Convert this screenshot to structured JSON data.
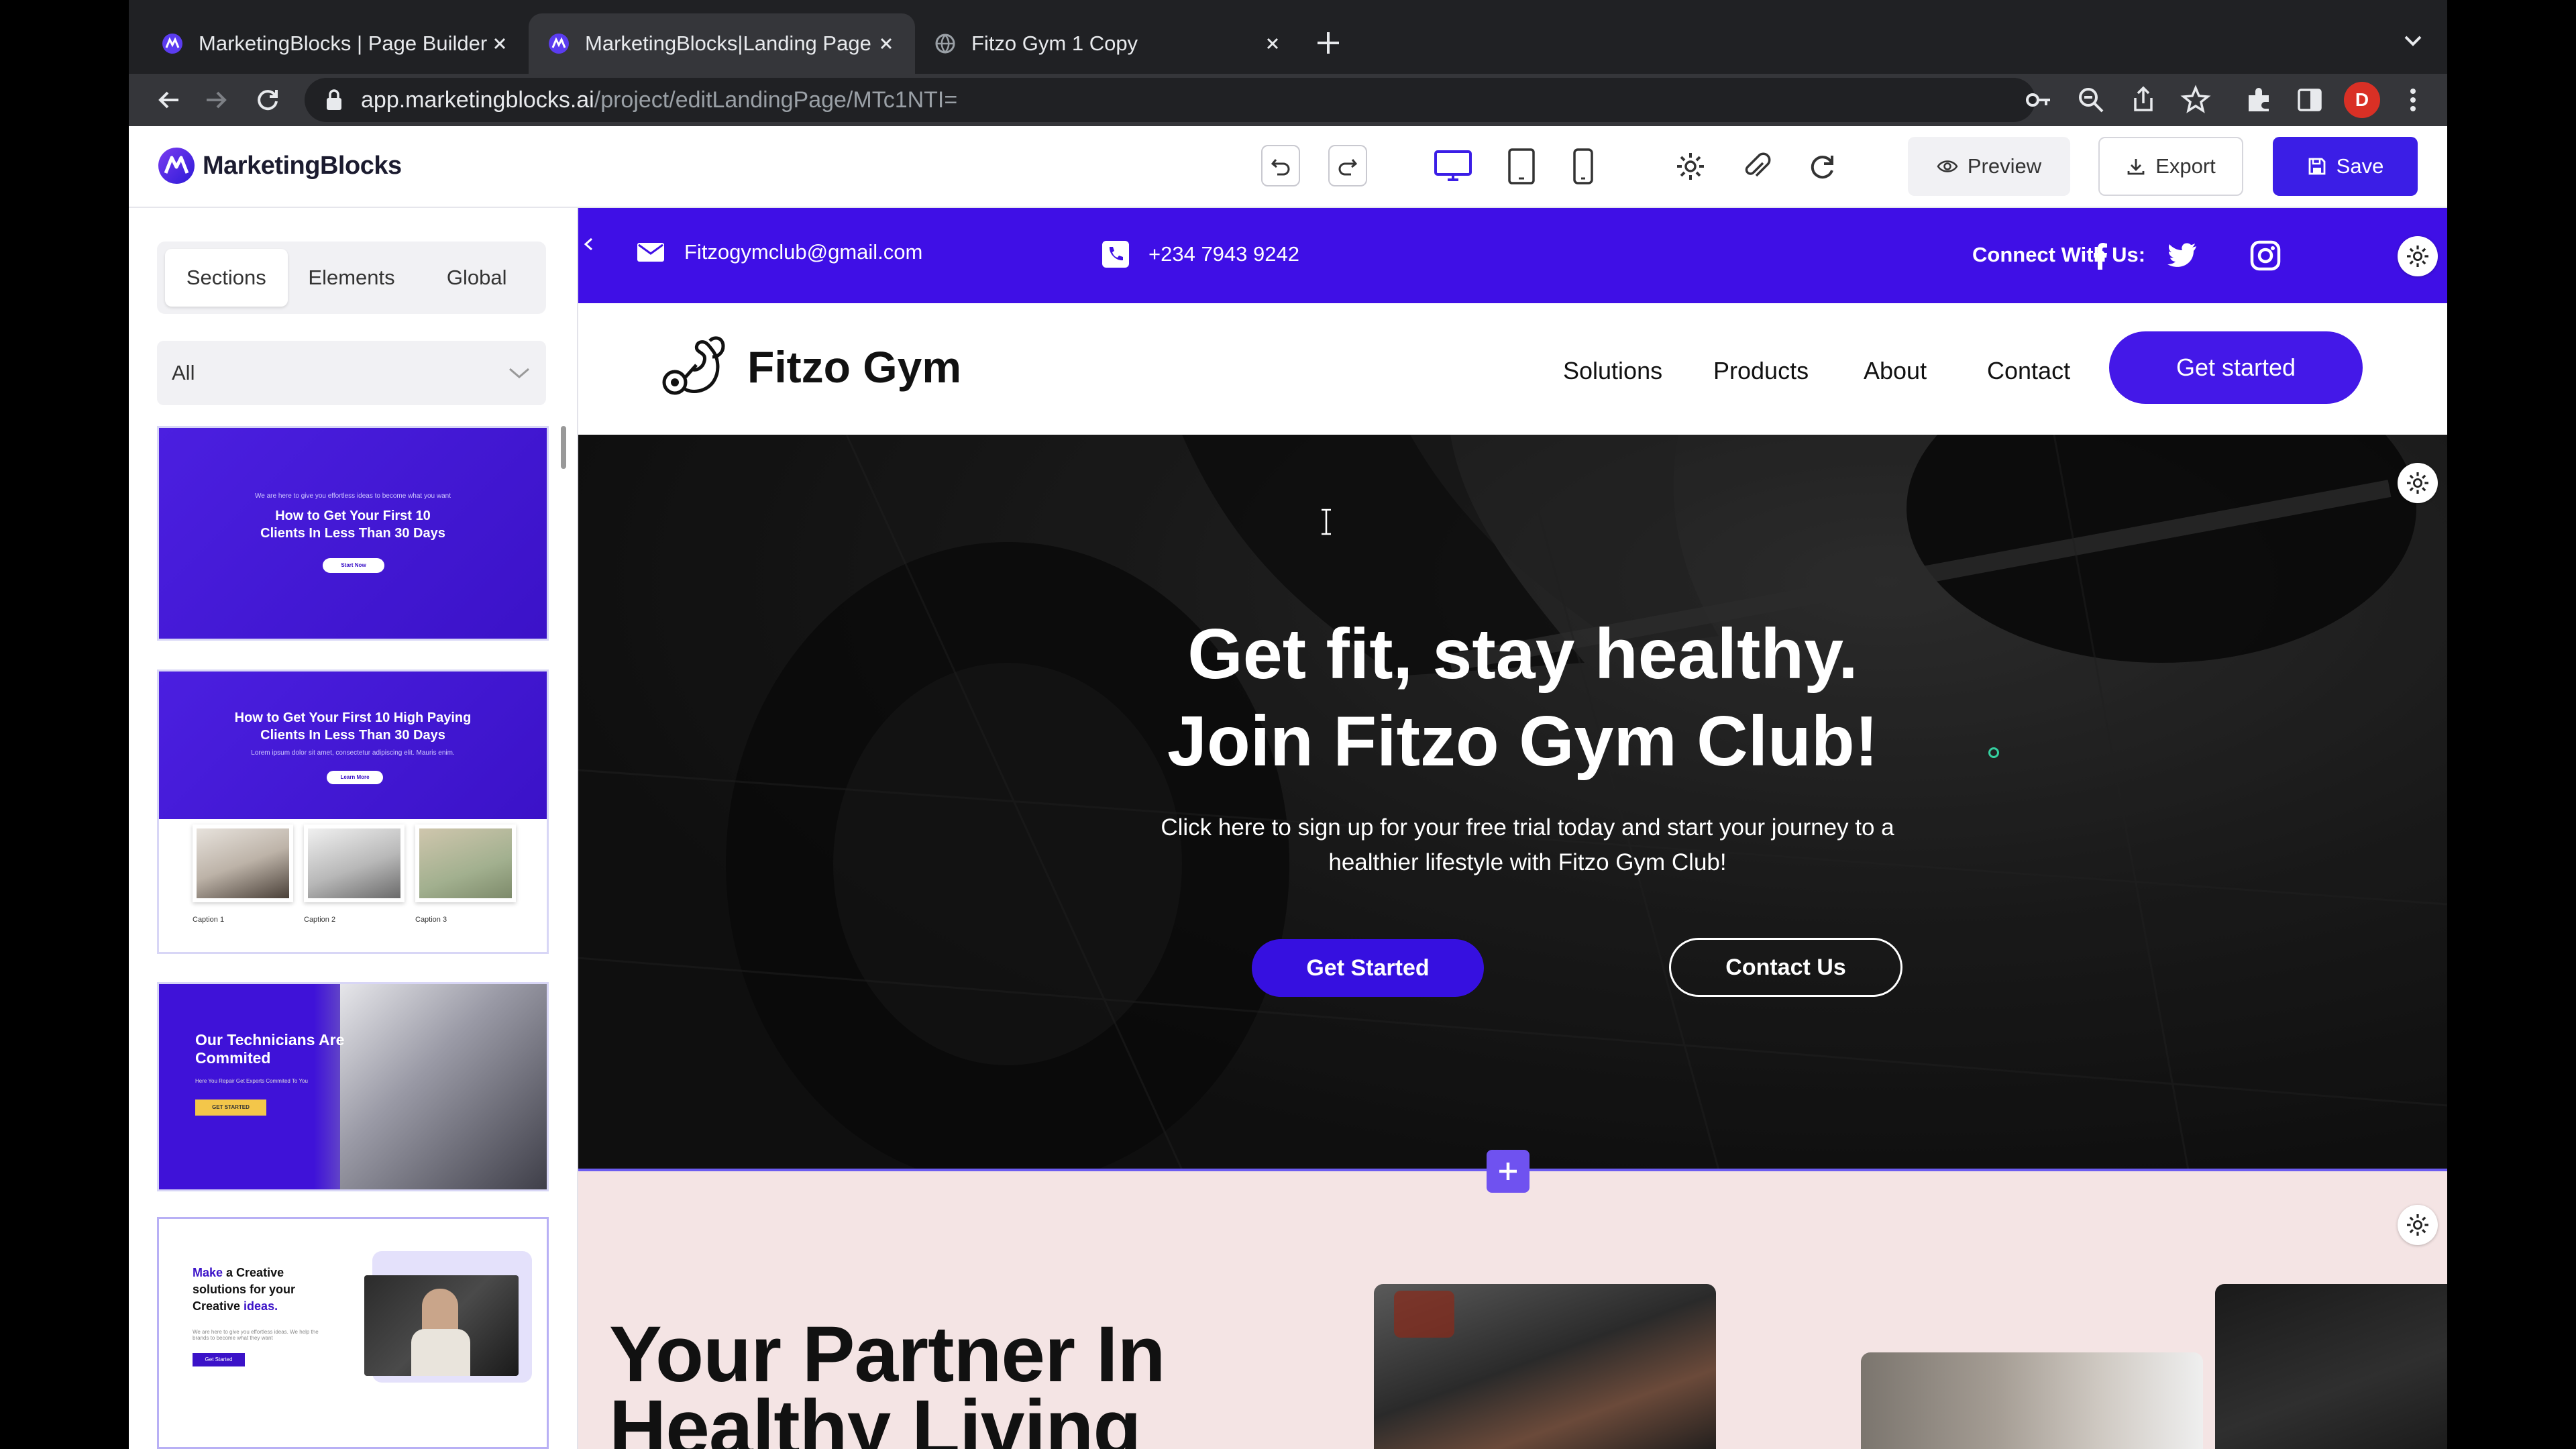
{
  "browser": {
    "tabs": [
      {
        "label": "MarketingBlocks | Page Builder",
        "active": false
      },
      {
        "label": "MarketingBlocks|Landing Page",
        "active": true
      },
      {
        "label": "Fitzo Gym 1 Copy",
        "active": false
      }
    ],
    "url_host": "app.marketingblocks.ai",
    "url_path": "/project/editLandingPage/MTc1NTI=",
    "profile_initial": "D"
  },
  "app": {
    "logo_text": "MarketingBlocks",
    "preview_label": "Preview",
    "export_label": "Export",
    "save_label": "Save",
    "accent": "#3b1ee6"
  },
  "left_panel": {
    "tabs": [
      "Sections",
      "Elements",
      "Global"
    ],
    "active_tab": "Sections",
    "filter_value": "All",
    "thumbnails": {
      "t1": {
        "eyebrow": "We are here to give you effortless ideas to become what you want",
        "title": "How to Get Your First 10 Clients In Less Than 30 Days",
        "button": "Start Now"
      },
      "t2": {
        "title": "How to Get Your First 10 High Paying Clients In Less Than 30 Days",
        "lorem": "Lorem ipsum dolor sit amet, consectetur adipiscing elit. Mauris enim.",
        "button": "Learn More",
        "captions": [
          "Caption 1",
          "Caption 2",
          "Caption 3"
        ]
      },
      "t3": {
        "title": "Our Technicians Are Commited",
        "subtitle": "Here You Repair Get Experts Commited To You",
        "button": "GET STARTED"
      },
      "t4": {
        "title_bold": "Make",
        "title_rest": " a Creative solutions for your Creative ",
        "title_accent": "ideas.",
        "body": "We are here to give you effortless ideas. We help the brands to become what they want",
        "button": "Get Started"
      }
    }
  },
  "site": {
    "email": "Fitzogymclub@gmail.com",
    "phone": "+234 7943 9242",
    "connect_label": "Connect With Us:",
    "brand": "Fitzo Gym",
    "nav": [
      "Solutions",
      "Products",
      "About",
      "Contact"
    ],
    "nav_cta": "Get started",
    "hero_line1": "Get fit, stay healthy.",
    "hero_line2": "Join Fitzo Gym Club!",
    "hero_sub": "Click here to sign up for your free trial today and start your journey to a healthier lifestyle with Fitzo Gym Club!",
    "hero_cta_primary": "Get Started",
    "hero_cta_secondary": "Contact Us",
    "partner_heading_line1": "Your Partner In",
    "partner_heading_line2": "Healthy Living",
    "topbar_color": "#3f0fe6",
    "section_bg": "#f4e4e4"
  }
}
